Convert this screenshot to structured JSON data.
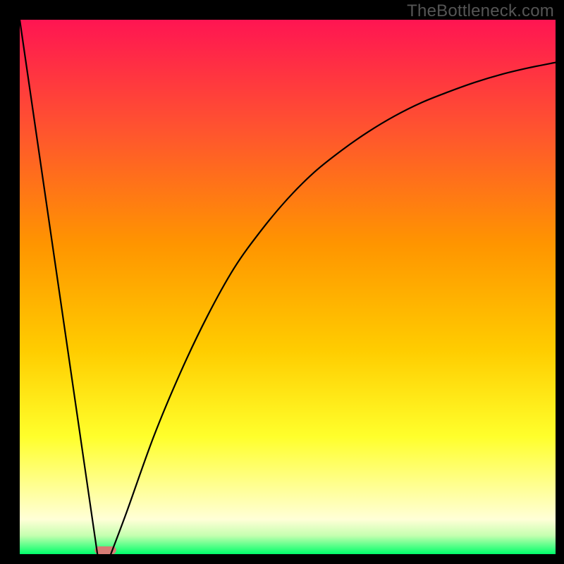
{
  "watermark": "TheBottleneck.com",
  "chart_data": {
    "type": "line",
    "title": "",
    "xlabel": "",
    "ylabel": "",
    "xlim": [
      0,
      100
    ],
    "ylim": [
      0,
      100
    ],
    "grid": false,
    "legend": false,
    "background_gradient": {
      "stops": [
        {
          "t": 0.0,
          "color": "#ff1552"
        },
        {
          "t": 0.2,
          "color": "#ff5230"
        },
        {
          "t": 0.42,
          "color": "#ff9500"
        },
        {
          "t": 0.62,
          "color": "#ffcd00"
        },
        {
          "t": 0.78,
          "color": "#ffff2b"
        },
        {
          "t": 0.88,
          "color": "#ffff9a"
        },
        {
          "t": 0.935,
          "color": "#ffffd7"
        },
        {
          "t": 0.965,
          "color": "#c6ffb0"
        },
        {
          "t": 1.0,
          "color": "#00ff6a"
        }
      ]
    },
    "series": [
      {
        "name": "left-branch",
        "x": [
          0,
          14.5
        ],
        "y": [
          100,
          0
        ]
      },
      {
        "name": "right-branch",
        "x": [
          17,
          20,
          25,
          30,
          35,
          40,
          45,
          50,
          55,
          60,
          65,
          70,
          75,
          80,
          85,
          90,
          95,
          100
        ],
        "y": [
          0,
          8,
          22,
          34,
          44.5,
          53.5,
          60.5,
          66.5,
          71.5,
          75.5,
          79,
          82,
          84.5,
          86.5,
          88.3,
          89.8,
          91,
          92
        ]
      }
    ],
    "optimal_marker": {
      "x_start": 14,
      "x_end": 18,
      "y": 0,
      "color": "#d77b74"
    }
  }
}
